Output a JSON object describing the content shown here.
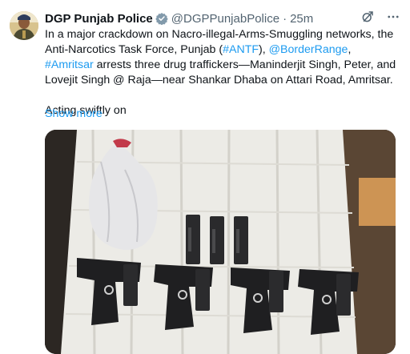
{
  "author": {
    "name": "DGP Punjab Police",
    "handle": "@DGPPunjabPolice",
    "separator": "·",
    "time": "25m"
  },
  "tweet": {
    "text_1": "In a major crackdown on Nacro-illegal-Arms-Smuggling networks, the Anti-Narcotics Task Force, Punjab (",
    "link_antf": "#ANTF",
    "text_2": "), ",
    "link_border": "@BorderRange",
    "text_3": ", ",
    "link_amritsar": "#Amritsar",
    "text_4": " arrests three drug traffickers—Maninderjit Singh, Peter, and Lovejit Singh @ Raja—near Shankar Dhaba on Attari Road, Amritsar.",
    "text_5": "Acting swiftly on",
    "show_more": "Show more"
  },
  "icons": {
    "verified": "verified-badge-icon",
    "grok": "grok-icon",
    "more": "more-icon"
  },
  "colors": {
    "link": "#1d9bf0",
    "secondary_text": "#536471",
    "verified": "#829aab"
  },
  "media": {
    "description_icon": "photo-seized-weapons"
  }
}
